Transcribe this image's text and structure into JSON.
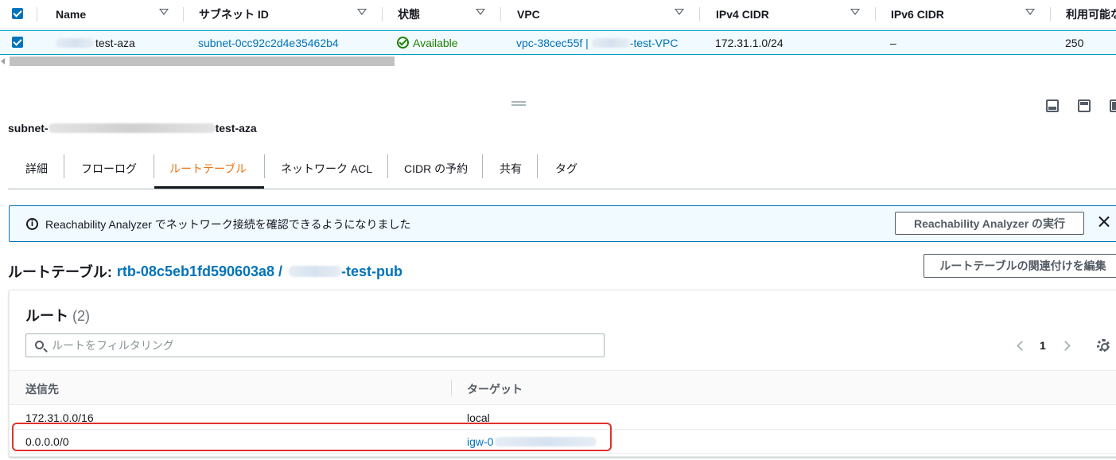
{
  "subnets_table": {
    "columns": [
      "Name",
      "サブネット ID",
      "状態",
      "VPC",
      "IPv4 CIDR",
      "IPv6 CIDR",
      "利用可能な"
    ],
    "row": {
      "name_suffix": "test-aza",
      "subnet_id": "subnet-0cc92c2d4e35462b4",
      "state": "Available",
      "vpc_id": "vpc-38cec55f |",
      "vpc_name_suffix": "-test-VPC",
      "ipv4_cidr": "172.31.1.0/24",
      "ipv6_cidr": "–",
      "available_ips": "250"
    },
    "colors": {
      "selected_row_bg": "#f1faff",
      "selected_row_border": "#00a1c9",
      "status_ok": "#1d8102"
    }
  },
  "detail": {
    "subnet_title_prefix": "subnet-",
    "subnet_title_suffix": "test-aza",
    "tabs": [
      "詳細",
      "フローログ",
      "ルートテーブル",
      "ネットワーク ACL",
      "CIDR の予約",
      "共有",
      "タグ"
    ],
    "active_tab": "ルートテーブル",
    "alert": {
      "text": "Reachability Analyzer でネットワーク接続を確認できるようになりました",
      "button": "Reachability Analyzer の実行"
    },
    "route_table": {
      "heading_label": "ルートテーブル:",
      "id": "rtb-08c5eb1fd590603a8 /",
      "name_suffix": "-test-pub",
      "edit_button": "ルートテーブルの関連付けを編集"
    },
    "routes": {
      "title": "ルート",
      "count": "(2)",
      "search_placeholder": "ルートをフィルタリング",
      "page": "1",
      "columns": [
        "送信先",
        "ターゲット"
      ],
      "rows": [
        {
          "destination": "172.31.0.0/16",
          "target": "local"
        },
        {
          "destination": "0.0.0.0/0",
          "target": "igw-0"
        }
      ],
      "highlight_color": "#e0322d"
    }
  },
  "colors": {
    "link": "#0073bb",
    "active_tab": "#ec7211",
    "info_border": "#0073bb"
  }
}
